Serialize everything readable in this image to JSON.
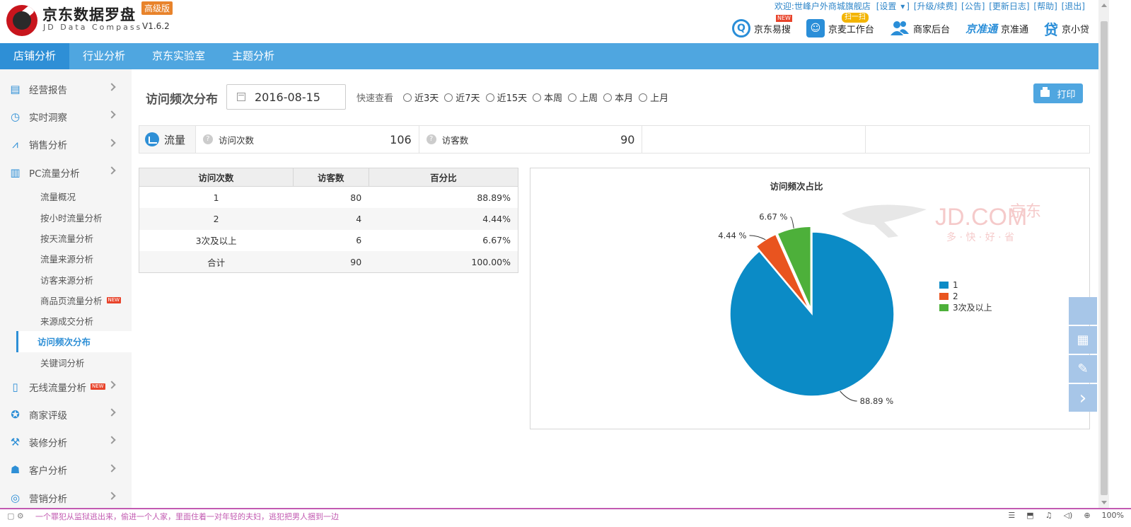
{
  "header": {
    "title": "京东数据罗盘",
    "badge": "高级版",
    "subtitle": "JD Data Compass",
    "version": "V1.6.2",
    "toplinks": [
      "欢迎:世峰户外商城旗舰店",
      "[设置",
      "]",
      "[升级/续费]",
      "[公告]",
      "[更新日志]",
      "[帮助]",
      "[退出]"
    ],
    "settings_caret": "▾",
    "quicknav": [
      {
        "label": "京东易搜",
        "icon": "search-icon",
        "badge": "NEW"
      },
      {
        "label": "京麦工作台",
        "icon": "robot-icon",
        "badge": "扫一扫"
      },
      {
        "label": "商家后台",
        "icon": "users-icon",
        "badge": ""
      },
      {
        "label": "京准通",
        "icon": "jzt-logo-icon",
        "badge": ""
      },
      {
        "label": "京小贷",
        "icon": "loan-icon",
        "badge": ""
      }
    ],
    "quicknav_glyphs": [
      "Q",
      "☺",
      "",
      "京准通",
      "贷"
    ]
  },
  "mainnav": [
    "店铺分析",
    "行业分析",
    "京东实验室",
    "主题分析"
  ],
  "sidebar": {
    "top_items": [
      {
        "label": "经营报告",
        "icon": "report-icon"
      },
      {
        "label": "实时洞察",
        "icon": "clock-icon"
      },
      {
        "label": "销售分析",
        "icon": "trend-icon"
      },
      {
        "label": "PC流量分析",
        "icon": "bar-chart-icon"
      }
    ],
    "icon_glyphs": [
      "▤",
      "◷",
      "⩘",
      "▥",
      "▯",
      "✪",
      "⚒",
      "☗",
      "◎"
    ],
    "sub_items": [
      "流量概况",
      "按小时流量分析",
      "按天流量分析",
      "流量来源分析",
      "访客来源分析",
      "商品页流量分析",
      "来源成交分析",
      "访问频次分布",
      "关键词分析"
    ],
    "new_tag": "NEW",
    "bottom_items": [
      {
        "label": "无线流量分析",
        "icon": "mobile-icon"
      },
      {
        "label": "商家评级",
        "icon": "award-icon"
      },
      {
        "label": "装修分析",
        "icon": "brush-icon"
      },
      {
        "label": "客户分析",
        "icon": "user-icon"
      },
      {
        "label": "营销分析",
        "icon": "target-icon"
      }
    ]
  },
  "content": {
    "title": "访问频次分布",
    "date": "2016-08-15",
    "quick_label": "快速查看",
    "quick_options": [
      "近3天",
      "近7天",
      "近15天",
      "本周",
      "上周",
      "本月",
      "上月"
    ],
    "print_label": "打印",
    "stats": {
      "label": "流量",
      "items": [
        {
          "name": "访问次数",
          "value": "106"
        },
        {
          "name": "访客数",
          "value": "90"
        }
      ]
    },
    "table": {
      "headers": [
        "访问次数",
        "访客数",
        "百分比"
      ],
      "rows": [
        [
          "1",
          "80",
          "88.89%"
        ],
        [
          "2",
          "4",
          "4.44%"
        ],
        [
          "3次及以上",
          "6",
          "6.67%"
        ],
        [
          "合计",
          "90",
          "100.00%"
        ]
      ]
    }
  },
  "chart_data": {
    "type": "pie",
    "title": "访问频次占比",
    "categories": [
      "1",
      "2",
      "3次及以上"
    ],
    "values": [
      88.89,
      4.44,
      6.67
    ],
    "data_labels": [
      "88.89 %",
      "4.44 %",
      "6.67 %"
    ],
    "colors": [
      "#0b8bc6",
      "#e9541f",
      "#4db03a"
    ],
    "legend": "right",
    "watermark": {
      "brand": "JD.COM",
      "brand_cn": "京东",
      "slogan": "多 · 快 · 好 · 省"
    }
  },
  "floating_tools": [
    "",
    "qr-code-icon",
    "edit-icon",
    "chevron-right-icon"
  ],
  "floating_glyphs": [
    "",
    "▦",
    "✎",
    "›"
  ],
  "statusbar": {
    "ticker": "一个罪犯从监狱逃出来，偷进一个人家，里面住着一对年轻的夫妇，逃犯把男人捆到一边",
    "zoom": "100%",
    "icons": [
      "☰",
      "⬒",
      "♫",
      "◁)",
      "⊕"
    ]
  }
}
